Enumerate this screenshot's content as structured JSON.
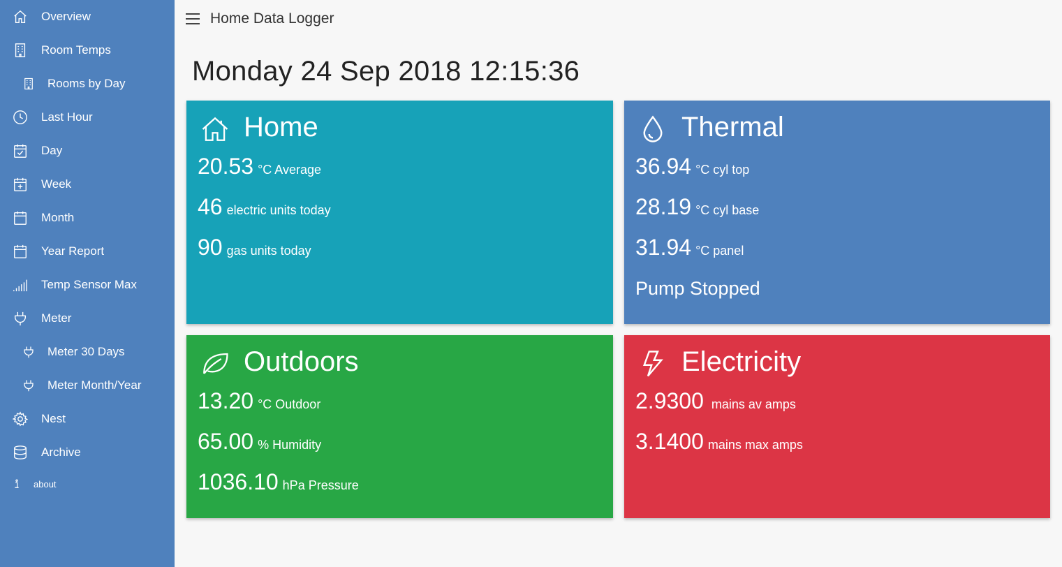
{
  "sidebar": {
    "items": [
      {
        "label": "Overview",
        "icon": "home-icon"
      },
      {
        "label": "Room Temps",
        "icon": "building-icon"
      },
      {
        "label": "Rooms by Day",
        "icon": "building-icon"
      },
      {
        "label": "Last Hour",
        "icon": "clock-icon"
      },
      {
        "label": "Day",
        "icon": "calendar-check-icon"
      },
      {
        "label": "Week",
        "icon": "calendar-plus-icon"
      },
      {
        "label": "Month",
        "icon": "calendar-icon"
      },
      {
        "label": "Year Report",
        "icon": "calendar-icon"
      },
      {
        "label": "Temp Sensor Max",
        "icon": "signal-bars-icon"
      },
      {
        "label": "Meter",
        "icon": "plug-icon"
      },
      {
        "label": "Meter 30 Days",
        "icon": "plug-icon"
      },
      {
        "label": "Meter Month/Year",
        "icon": "plug-icon"
      },
      {
        "label": "Nest",
        "icon": "gear-icon"
      },
      {
        "label": "Archive",
        "icon": "database-icon"
      },
      {
        "label": "about",
        "icon": "info-icon"
      }
    ]
  },
  "header": {
    "title": "Home Data Logger",
    "datetime": "Monday 24 Sep 2018 12:15:36"
  },
  "cards": {
    "home": {
      "title": "Home",
      "icon": "home-icon",
      "rows": [
        {
          "value": "20.53",
          "unit": "°C Average"
        },
        {
          "value": "46",
          "unit": "electric units today"
        },
        {
          "value": "90",
          "unit": "gas units today"
        }
      ]
    },
    "thermal": {
      "title": "Thermal",
      "icon": "droplet-icon",
      "rows": [
        {
          "value": "36.94",
          "unit": "°C cyl top"
        },
        {
          "value": "28.19",
          "unit": "°C cyl base"
        },
        {
          "value": "31.94",
          "unit": "°C panel"
        }
      ],
      "status": "Pump Stopped"
    },
    "outdoors": {
      "title": "Outdoors",
      "icon": "leaf-icon",
      "rows": [
        {
          "value": "13.20",
          "unit": "°C Outdoor"
        },
        {
          "value": "65.00",
          "unit": "% Humidity"
        },
        {
          "value": "1036.10",
          "unit": "hPa Pressure"
        }
      ]
    },
    "electricity": {
      "title": "Electricity",
      "icon": "lightning-icon",
      "rows": [
        {
          "value": "2.9300",
          "unit": " mains av amps"
        },
        {
          "value": "3.1400",
          "unit": "mains max amps"
        }
      ]
    }
  },
  "colors": {
    "sidebar": "#4f81bd",
    "home": "#17a2b8",
    "thermal": "#4f81bd",
    "outdoors": "#28a745",
    "electricity": "#dc3545"
  }
}
